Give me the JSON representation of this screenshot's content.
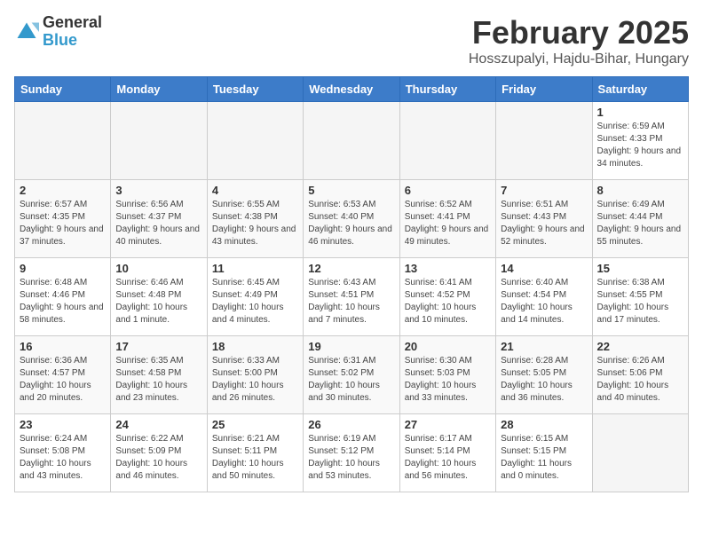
{
  "logo": {
    "general": "General",
    "blue": "Blue"
  },
  "header": {
    "month": "February 2025",
    "location": "Hosszupalyi, Hajdu-Bihar, Hungary"
  },
  "weekdays": [
    "Sunday",
    "Monday",
    "Tuesday",
    "Wednesday",
    "Thursday",
    "Friday",
    "Saturday"
  ],
  "weeks": [
    [
      {
        "day": "",
        "info": ""
      },
      {
        "day": "",
        "info": ""
      },
      {
        "day": "",
        "info": ""
      },
      {
        "day": "",
        "info": ""
      },
      {
        "day": "",
        "info": ""
      },
      {
        "day": "",
        "info": ""
      },
      {
        "day": "1",
        "info": "Sunrise: 6:59 AM\nSunset: 4:33 PM\nDaylight: 9 hours and 34 minutes."
      }
    ],
    [
      {
        "day": "2",
        "info": "Sunrise: 6:57 AM\nSunset: 4:35 PM\nDaylight: 9 hours and 37 minutes."
      },
      {
        "day": "3",
        "info": "Sunrise: 6:56 AM\nSunset: 4:37 PM\nDaylight: 9 hours and 40 minutes."
      },
      {
        "day": "4",
        "info": "Sunrise: 6:55 AM\nSunset: 4:38 PM\nDaylight: 9 hours and 43 minutes."
      },
      {
        "day": "5",
        "info": "Sunrise: 6:53 AM\nSunset: 4:40 PM\nDaylight: 9 hours and 46 minutes."
      },
      {
        "day": "6",
        "info": "Sunrise: 6:52 AM\nSunset: 4:41 PM\nDaylight: 9 hours and 49 minutes."
      },
      {
        "day": "7",
        "info": "Sunrise: 6:51 AM\nSunset: 4:43 PM\nDaylight: 9 hours and 52 minutes."
      },
      {
        "day": "8",
        "info": "Sunrise: 6:49 AM\nSunset: 4:44 PM\nDaylight: 9 hours and 55 minutes."
      }
    ],
    [
      {
        "day": "9",
        "info": "Sunrise: 6:48 AM\nSunset: 4:46 PM\nDaylight: 9 hours and 58 minutes."
      },
      {
        "day": "10",
        "info": "Sunrise: 6:46 AM\nSunset: 4:48 PM\nDaylight: 10 hours and 1 minute."
      },
      {
        "day": "11",
        "info": "Sunrise: 6:45 AM\nSunset: 4:49 PM\nDaylight: 10 hours and 4 minutes."
      },
      {
        "day": "12",
        "info": "Sunrise: 6:43 AM\nSunset: 4:51 PM\nDaylight: 10 hours and 7 minutes."
      },
      {
        "day": "13",
        "info": "Sunrise: 6:41 AM\nSunset: 4:52 PM\nDaylight: 10 hours and 10 minutes."
      },
      {
        "day": "14",
        "info": "Sunrise: 6:40 AM\nSunset: 4:54 PM\nDaylight: 10 hours and 14 minutes."
      },
      {
        "day": "15",
        "info": "Sunrise: 6:38 AM\nSunset: 4:55 PM\nDaylight: 10 hours and 17 minutes."
      }
    ],
    [
      {
        "day": "16",
        "info": "Sunrise: 6:36 AM\nSunset: 4:57 PM\nDaylight: 10 hours and 20 minutes."
      },
      {
        "day": "17",
        "info": "Sunrise: 6:35 AM\nSunset: 4:58 PM\nDaylight: 10 hours and 23 minutes."
      },
      {
        "day": "18",
        "info": "Sunrise: 6:33 AM\nSunset: 5:00 PM\nDaylight: 10 hours and 26 minutes."
      },
      {
        "day": "19",
        "info": "Sunrise: 6:31 AM\nSunset: 5:02 PM\nDaylight: 10 hours and 30 minutes."
      },
      {
        "day": "20",
        "info": "Sunrise: 6:30 AM\nSunset: 5:03 PM\nDaylight: 10 hours and 33 minutes."
      },
      {
        "day": "21",
        "info": "Sunrise: 6:28 AM\nSunset: 5:05 PM\nDaylight: 10 hours and 36 minutes."
      },
      {
        "day": "22",
        "info": "Sunrise: 6:26 AM\nSunset: 5:06 PM\nDaylight: 10 hours and 40 minutes."
      }
    ],
    [
      {
        "day": "23",
        "info": "Sunrise: 6:24 AM\nSunset: 5:08 PM\nDaylight: 10 hours and 43 minutes."
      },
      {
        "day": "24",
        "info": "Sunrise: 6:22 AM\nSunset: 5:09 PM\nDaylight: 10 hours and 46 minutes."
      },
      {
        "day": "25",
        "info": "Sunrise: 6:21 AM\nSunset: 5:11 PM\nDaylight: 10 hours and 50 minutes."
      },
      {
        "day": "26",
        "info": "Sunrise: 6:19 AM\nSunset: 5:12 PM\nDaylight: 10 hours and 53 minutes."
      },
      {
        "day": "27",
        "info": "Sunrise: 6:17 AM\nSunset: 5:14 PM\nDaylight: 10 hours and 56 minutes."
      },
      {
        "day": "28",
        "info": "Sunrise: 6:15 AM\nSunset: 5:15 PM\nDaylight: 11 hours and 0 minutes."
      },
      {
        "day": "",
        "info": ""
      }
    ]
  ]
}
